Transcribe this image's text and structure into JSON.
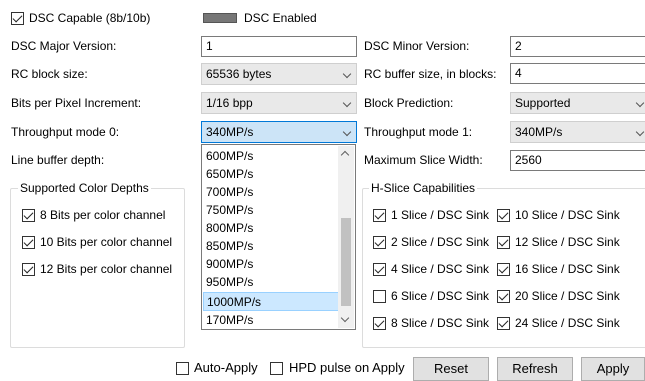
{
  "top": {
    "dsc_capable_label": "DSC Capable (8b/10b)",
    "dsc_capable_checked": true,
    "dsc_enabled_label": "DSC Enabled"
  },
  "fields": {
    "dsc_major_label": "DSC Major Version:",
    "dsc_major_value": "1",
    "dsc_minor_label": "DSC Minor Version:",
    "dsc_minor_value": "2",
    "rc_block_label": "RC block size:",
    "rc_block_value": "65536 bytes",
    "rc_buffer_label": "RC buffer size, in blocks:",
    "rc_buffer_value": "4",
    "bpp_inc_label": "Bits per Pixel Increment:",
    "bpp_inc_value": "1/16 bpp",
    "block_pred_label": "Block Prediction:",
    "block_pred_value": "Supported",
    "tp0_label": "Throughput mode 0:",
    "tp0_value": "340MP/s",
    "tp1_label": "Throughput mode 1:",
    "tp1_value": "340MP/s",
    "line_buf_label": "Line buffer depth:",
    "max_slice_label": "Maximum Slice Width:",
    "max_slice_value": "2560"
  },
  "dropdown": {
    "items": [
      "600MP/s",
      "650MP/s",
      "700MP/s",
      "750MP/s",
      "800MP/s",
      "850MP/s",
      "900MP/s",
      "950MP/s",
      "1000MP/s",
      "170MP/s"
    ],
    "selected": "1000MP/s"
  },
  "color_depths": {
    "title": "Supported Color Depths",
    "items": [
      {
        "label": "8 Bits per color channel",
        "checked": true
      },
      {
        "label": "10 Bits per color channel",
        "checked": true
      },
      {
        "label": "12 Bits per color channel",
        "checked": true
      }
    ]
  },
  "hslice": {
    "title": "H-Slice Capabilities",
    "left": [
      {
        "label": "1 Slice / DSC Sink",
        "checked": true
      },
      {
        "label": "2 Slice / DSC Sink",
        "checked": true
      },
      {
        "label": "4 Slice / DSC Sink",
        "checked": true
      },
      {
        "label": "6 Slice / DSC Sink",
        "checked": false
      },
      {
        "label": "8 Slice / DSC Sink",
        "checked": true
      }
    ],
    "right": [
      {
        "label": "10 Slice / DSC Sink",
        "checked": true
      },
      {
        "label": "12 Slice / DSC Sink",
        "checked": true
      },
      {
        "label": "16 Slice / DSC Sink",
        "checked": true
      },
      {
        "label": "20 Slice / DSC Sink",
        "checked": true
      },
      {
        "label": "24 Slice / DSC Sink",
        "checked": true
      }
    ]
  },
  "bottom": {
    "auto_apply_label": "Auto-Apply",
    "hpd_pulse_label": "HPD pulse on Apply",
    "reset_label": "Reset",
    "refresh_label": "Refresh",
    "apply_label": "Apply"
  }
}
